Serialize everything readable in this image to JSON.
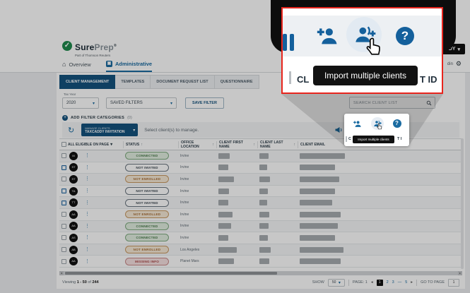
{
  "brand": {
    "name_bold": "Sure",
    "name_light": "Prep",
    "reg": "®",
    "tagline": "Part of Thomson Reuters"
  },
  "header": {
    "account_button": "TAXCADDY",
    "nav_overview": "Overview",
    "nav_admin": "Administrative",
    "nav_right_text": "din"
  },
  "icons": {
    "gear": "⚙",
    "home": "⌂",
    "refresh": "↻",
    "chevron_down": "▾",
    "sort_up": "↑",
    "dots": "⋮",
    "plus": "+",
    "arrow_left": "◂",
    "arrow_right": "▸",
    "question": "?"
  },
  "tabs": {
    "items": [
      "CLIENT MANAGEMENT",
      "TEMPLATES",
      "DOCUMENT REQUEST LIST",
      "QUESTIONNAIRE"
    ]
  },
  "filters": {
    "tax_year_label": "Tax Year",
    "tax_year_value": "2020",
    "saved_filters_value": "SAVED FILTERS",
    "save_filter_button": "SAVE FILTER",
    "add_filter_label": "ADD FILTER CATEGORIES",
    "add_filter_count": "(0)",
    "search_placeholder": "SEARCH CLIENT LIST"
  },
  "toolbar": {
    "manage_label": "MANAGE CLIENTS",
    "manage_value": "TAXCADDY INVITATION",
    "hint": "Select client(s) to manage."
  },
  "spotlight": {
    "tooltip": "Import multiple clients",
    "header_fragment_left": "C",
    "header_fragment_right": "T I"
  },
  "callout": {
    "tooltip": "Import multiple clients",
    "header_fragment_left": "CL",
    "header_fragment_right": "T ID"
  },
  "table": {
    "select_all_label": "ALL ELIGIBLE ON PAGE",
    "columns": [
      "STATUS",
      "OFFICE LOCATION",
      "CLIENT FIRST NAME",
      "CLIENT LAST NAME",
      "CLIENT EMAIL"
    ],
    "rows": [
      {
        "initials": "M",
        "status": "CONNECTED",
        "status_type": "connected",
        "location": "Irvine",
        "selected": false,
        "fn": 16,
        "ln": 13,
        "em": 64
      },
      {
        "initials": "ST",
        "status": "NOT INVITED",
        "status_type": "notinvited",
        "location": "Irvine",
        "selected": true,
        "fn": 14,
        "ln": 11,
        "em": 50
      },
      {
        "initials": "ST",
        "status": "NOT ENROLLED",
        "status_type": "notenrolled",
        "location": "Irvine",
        "selected": false,
        "fn": 22,
        "ln": 15,
        "em": 56
      },
      {
        "initials": "TA",
        "status": "NOT INVITED",
        "status_type": "notinvited",
        "location": "Irvine",
        "selected": true,
        "fn": 15,
        "ln": 12,
        "em": 50
      },
      {
        "initials": "TT",
        "status": "NOT INVITED",
        "status_type": "notinvited",
        "location": "Irvine",
        "selected": true,
        "fn": 14,
        "ln": 11,
        "em": 46
      },
      {
        "initials": "AA",
        "status": "NOT ENROLLED",
        "status_type": "notenrolled",
        "location": "Irvine",
        "selected": false,
        "fn": 20,
        "ln": 14,
        "em": 58
      },
      {
        "initials": "AA",
        "status": "CONNECTED",
        "status_type": "connected",
        "location": "Irvine",
        "selected": false,
        "fn": 18,
        "ln": 13,
        "em": 54
      },
      {
        "initials": "AS",
        "status": "CONNECTED",
        "status_type": "connected",
        "location": "Irvine",
        "selected": false,
        "fn": 14,
        "ln": 12,
        "em": 50
      },
      {
        "initials": "AB",
        "status": "NOT ENROLLED",
        "status_type": "notenrolled",
        "location": "Los Angeles",
        "selected": false,
        "fn": 26,
        "ln": 16,
        "em": 62
      },
      {
        "initials": "AA",
        "status": "MISSING INFO",
        "status_type": "missing",
        "location": "Planet Mars",
        "selected": false,
        "fn": 22,
        "ln": 14,
        "em": 58
      }
    ]
  },
  "pagination": {
    "viewing_label": "Viewing",
    "viewing_range": "1 - 50",
    "viewing_of": "of",
    "viewing_total": "244",
    "show_label": "SHOW",
    "show_value": "50",
    "page_label": "PAGE: 1",
    "pages": [
      "1",
      "2",
      "3",
      "—",
      "5"
    ],
    "goto_label": "GO TO PAGE",
    "goto_value": "1"
  },
  "colors": {
    "brand_blue": "#14537e",
    "icon_blue": "#1a6ba1",
    "callout_red": "#e8251d",
    "tooltip_bg": "#121212",
    "connected_green": "#4e7d50",
    "not_enrolled_orange": "#a9713a",
    "missing_red": "#ab4a4a"
  }
}
